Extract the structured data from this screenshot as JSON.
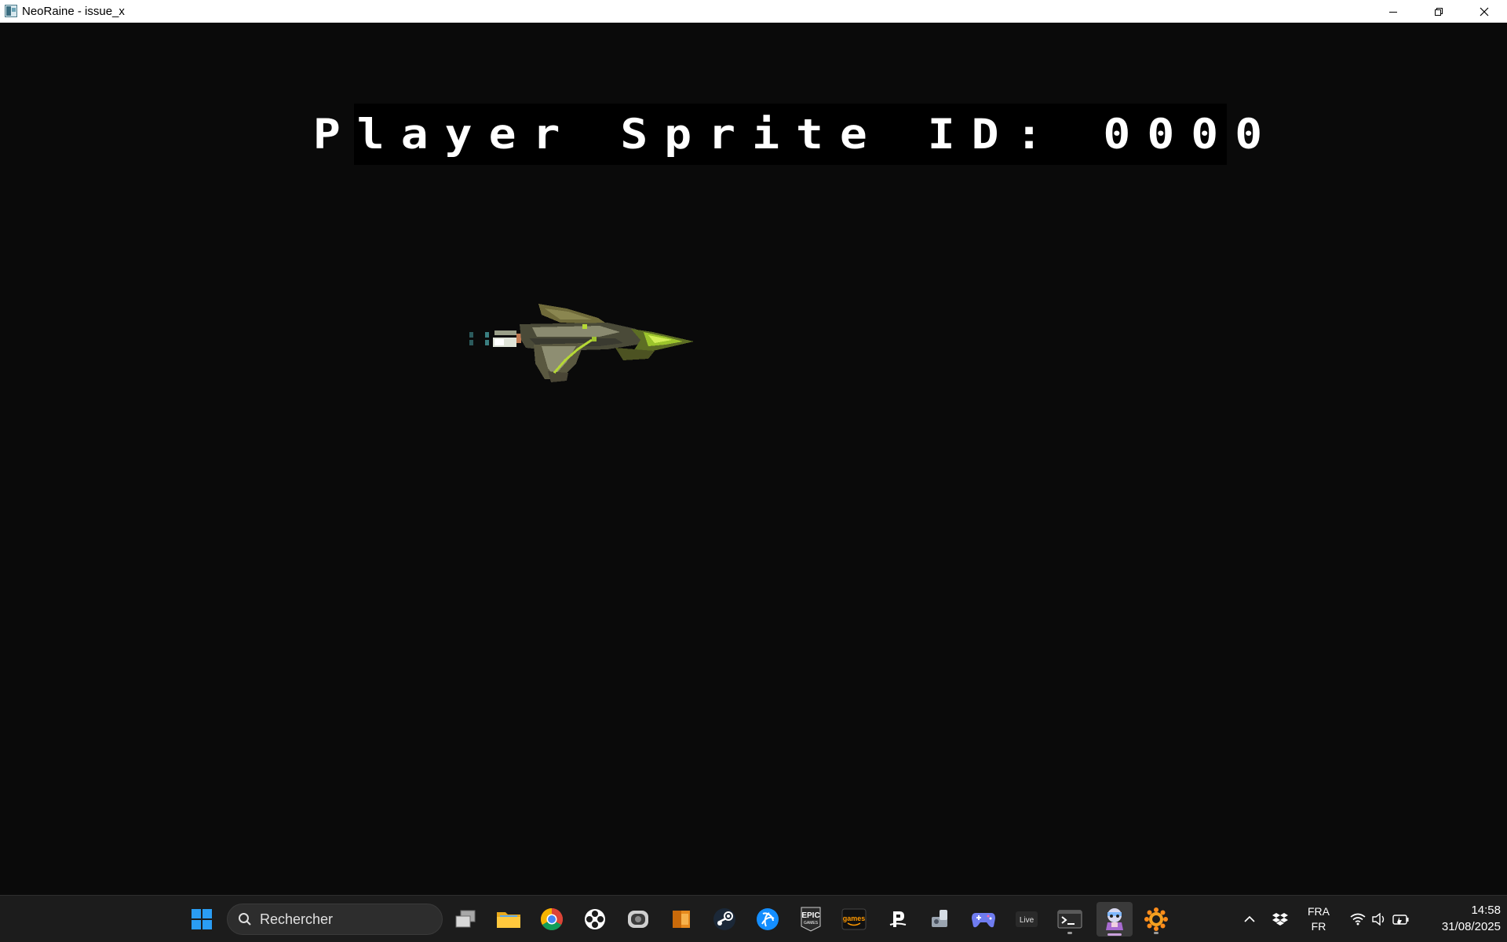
{
  "window": {
    "title": "NeoRaine - issue_x"
  },
  "game": {
    "banner_text": "Player Sprite ID: 0000",
    "background_color": "#0a0a0a",
    "banner_text_color": "#ffffff"
  },
  "taskbar": {
    "search_placeholder": "Rechercher",
    "apps": [
      {
        "icon": "windows-start-icon"
      },
      {
        "icon": "search-icon"
      },
      {
        "icon": "task-view-icon"
      },
      {
        "icon": "file-explorer-icon"
      },
      {
        "icon": "chrome-icon"
      },
      {
        "icon": "gamepad-app-icon"
      },
      {
        "icon": "steam-deck-app-icon"
      },
      {
        "icon": "folder-app-icon"
      },
      {
        "icon": "steam-icon"
      },
      {
        "icon": "battlenet-icon"
      },
      {
        "icon": "epic-games-icon"
      },
      {
        "icon": "amazon-games-icon"
      },
      {
        "icon": "ea-app-icon"
      },
      {
        "icon": "ubisoft-connect-icon"
      },
      {
        "icon": "controller-app-icon"
      },
      {
        "icon": "live-app-icon"
      },
      {
        "icon": "terminal-icon"
      },
      {
        "icon": "neoraine-icon"
      },
      {
        "icon": "xnview-icon"
      }
    ],
    "epic_label": "EPIC",
    "epic_sublabel": "GAMES",
    "amazon_label": "games",
    "live_label": "Live",
    "tray": {
      "language_top": "FRA",
      "language_bottom": "FR",
      "time": "14:58",
      "date": "31/08/2025"
    }
  }
}
